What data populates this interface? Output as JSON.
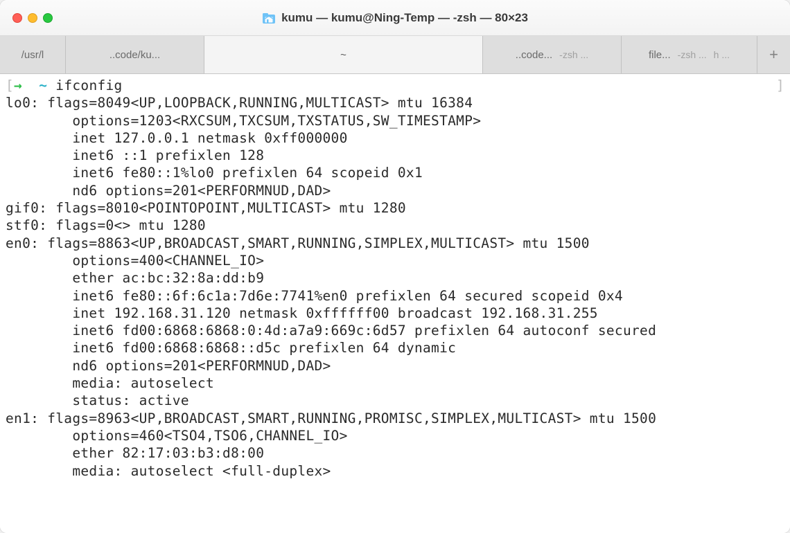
{
  "window": {
    "title": "kumu — kumu@Ning-Temp — -zsh — 80×23"
  },
  "tabs": {
    "t0": {
      "label": "/usr/l"
    },
    "t1": {
      "label": "..code/ku..."
    },
    "t2": {
      "label": "~"
    },
    "t3": {
      "label": "..code...",
      "sub": "-zsh ..."
    },
    "t4": {
      "label": "file...",
      "sub": "-zsh ...",
      "tail": "h ..."
    },
    "add": "+"
  },
  "prompt": {
    "open": "[",
    "arrow": "→",
    "tilde": "~",
    "cmd": "ifconfig",
    "close": "]"
  },
  "output": {
    "l01": "lo0: flags=8049<UP,LOOPBACK,RUNNING,MULTICAST> mtu 16384",
    "l02": "        options=1203<RXCSUM,TXCSUM,TXSTATUS,SW_TIMESTAMP>",
    "l03": "        inet 127.0.0.1 netmask 0xff000000",
    "l04": "        inet6 ::1 prefixlen 128",
    "l05": "        inet6 fe80::1%lo0 prefixlen 64 scopeid 0x1",
    "l06": "        nd6 options=201<PERFORMNUD,DAD>",
    "l07": "gif0: flags=8010<POINTOPOINT,MULTICAST> mtu 1280",
    "l08": "stf0: flags=0<> mtu 1280",
    "l09": "en0: flags=8863<UP,BROADCAST,SMART,RUNNING,SIMPLEX,MULTICAST> mtu 1500",
    "l10": "        options=400<CHANNEL_IO>",
    "l11": "        ether ac:bc:32:8a:dd:b9",
    "l12": "        inet6 fe80::6f:6c1a:7d6e:7741%en0 prefixlen 64 secured scopeid 0x4",
    "l13": "        inet 192.168.31.120 netmask 0xffffff00 broadcast 192.168.31.255",
    "l14": "        inet6 fd00:6868:6868:0:4d:a7a9:669c:6d57 prefixlen 64 autoconf secured",
    "l15": "        inet6 fd00:6868:6868::d5c prefixlen 64 dynamic",
    "l16": "        nd6 options=201<PERFORMNUD,DAD>",
    "l17": "        media: autoselect",
    "l18": "        status: active",
    "l19": "en1: flags=8963<UP,BROADCAST,SMART,RUNNING,PROMISC,SIMPLEX,MULTICAST> mtu 1500",
    "l20": "        options=460<TSO4,TSO6,CHANNEL_IO>",
    "l21": "        ether 82:17:03:b3:d8:00",
    "l22": "        media: autoselect <full-duplex>"
  }
}
